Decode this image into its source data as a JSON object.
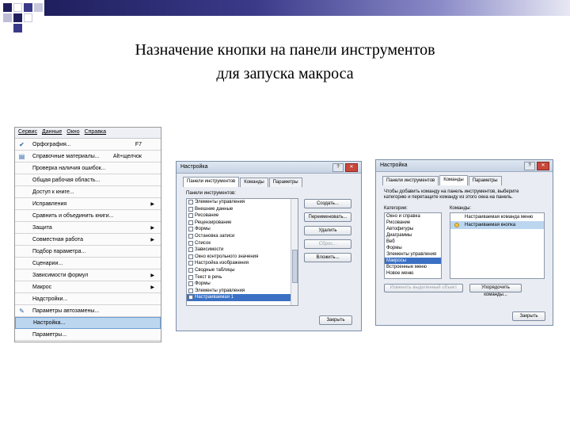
{
  "slide": {
    "title_line1": "Назначение кнопки на панели инструментов",
    "title_line2": "для запуска макроса",
    "gradient_colors": [
      "#1f1f5e",
      "#8a8ac8"
    ]
  },
  "menu": {
    "menubar": [
      "Сервис",
      "Данные",
      "Окно",
      "Справка"
    ],
    "items": [
      {
        "label": "Орфография...",
        "shortcut": "F7",
        "icon": "spellcheck-icon",
        "arrow": false
      },
      {
        "label": "Справочные материалы...",
        "shortcut": "Alt+щелчок",
        "icon": "book-icon",
        "arrow": false
      },
      {
        "label": "Проверка наличия ошибок...",
        "shortcut": "",
        "icon": "",
        "arrow": false
      },
      {
        "label": "Общая рабочая область...",
        "shortcut": "",
        "icon": "",
        "arrow": false
      },
      {
        "label": "Доступ к книге...",
        "shortcut": "",
        "icon": "",
        "arrow": false
      },
      {
        "label": "Исправления",
        "shortcut": "",
        "icon": "",
        "arrow": true
      },
      {
        "label": "Сравнить и объединить книги...",
        "shortcut": "",
        "icon": "",
        "arrow": false
      },
      {
        "label": "Защита",
        "shortcut": "",
        "icon": "",
        "arrow": true
      },
      {
        "label": "Совместная работа",
        "shortcut": "",
        "icon": "",
        "arrow": true
      },
      {
        "label": "Подбор параметра...",
        "shortcut": "",
        "icon": "",
        "arrow": false
      },
      {
        "label": "Сценарии...",
        "shortcut": "",
        "icon": "",
        "arrow": false
      },
      {
        "label": "Зависимости формул",
        "shortcut": "",
        "icon": "",
        "arrow": true
      },
      {
        "label": "Макрос",
        "shortcut": "",
        "icon": "",
        "arrow": true
      },
      {
        "label": "Надстройки...",
        "shortcut": "",
        "icon": "",
        "arrow": false
      },
      {
        "label": "Параметры автозамены...",
        "shortcut": "",
        "icon": "autocorrect-icon",
        "arrow": false
      },
      {
        "label": "Настройка...",
        "shortcut": "",
        "icon": "",
        "arrow": false
      },
      {
        "label": "Параметры...",
        "shortcut": "",
        "icon": "",
        "arrow": false
      }
    ],
    "selected_index": 15
  },
  "dialog1": {
    "title": "Настройка",
    "tabs": [
      "Панели инструментов",
      "Команды",
      "Параметры"
    ],
    "list_label": "Панели инструментов:",
    "toolbars": [
      {
        "label": "Элементы управления",
        "checked": false
      },
      {
        "label": "Внешние данные",
        "checked": false
      },
      {
        "label": "Рисование",
        "checked": false
      },
      {
        "label": "Рецензирование",
        "checked": false
      },
      {
        "label": "Формы",
        "checked": false
      },
      {
        "label": "Остановка записи",
        "checked": false
      },
      {
        "label": "Список",
        "checked": false
      },
      {
        "label": "Зависимости",
        "checked": false
      },
      {
        "label": "Окно контрольного значения",
        "checked": false
      },
      {
        "label": "Настройка изображения",
        "checked": false
      },
      {
        "label": "Сводные таблицы",
        "checked": false
      },
      {
        "label": "Текст в речь",
        "checked": false
      },
      {
        "label": "Формы",
        "checked": false
      },
      {
        "label": "Элементы управления",
        "checked": false
      },
      {
        "label": "Настраиваемая 1",
        "checked": true
      }
    ],
    "selected_index": 14,
    "buttons": [
      "Создать...",
      "Переименовать...",
      "Удалить",
      "Сброс...",
      "Вложить..."
    ],
    "close_label": "Закрыть"
  },
  "dialog2": {
    "title": "Настройка",
    "tabs": [
      "Панели инструментов",
      "Команды",
      "Параметры"
    ],
    "instruction": "Чтобы добавить команду на панель инструментов, выберите категорию и перетащите команду из этого окна на панель.",
    "categories_label": "Категории:",
    "commands_label": "Команды:",
    "categories": [
      "Окно и справка",
      "Рисование",
      "Автофигуры",
      "Диаграммы",
      "Веб",
      "Формы",
      "Элементы управления",
      "Макросы",
      "Встроенные меню",
      "Новое меню"
    ],
    "selected_category": 7,
    "commands": [
      {
        "label": "Настраиваемая команда меню",
        "icon": false
      },
      {
        "label": "Настраиваемая кнопка",
        "icon": true
      }
    ],
    "selected_command": 1,
    "selection_button": "Изменить выделенный объект",
    "rearrange_button": "Упорядочить команды...",
    "close_label": "Закрыть"
  }
}
